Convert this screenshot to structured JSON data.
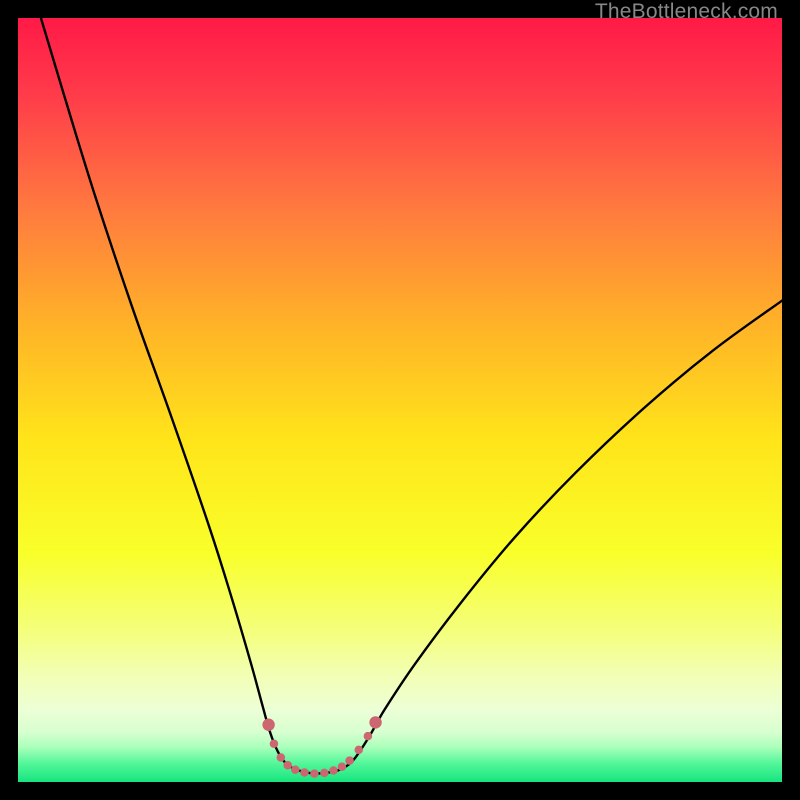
{
  "watermark": "TheBottleneck.com",
  "chart_data": {
    "type": "line",
    "title": "",
    "xlabel": "",
    "ylabel": "",
    "xlim": [
      0,
      100
    ],
    "ylim": [
      0,
      100
    ],
    "background_gradient_stops": [
      {
        "offset": 0.0,
        "color": "#ff1a47"
      },
      {
        "offset": 0.1,
        "color": "#ff3b4a"
      },
      {
        "offset": 0.25,
        "color": "#ff7a3f"
      },
      {
        "offset": 0.4,
        "color": "#ffb228"
      },
      {
        "offset": 0.55,
        "color": "#ffe41a"
      },
      {
        "offset": 0.7,
        "color": "#f9ff2a"
      },
      {
        "offset": 0.8,
        "color": "#f4ff7a"
      },
      {
        "offset": 0.86,
        "color": "#f2ffb4"
      },
      {
        "offset": 0.905,
        "color": "#edffd6"
      },
      {
        "offset": 0.935,
        "color": "#d7ffd0"
      },
      {
        "offset": 0.955,
        "color": "#a8ffba"
      },
      {
        "offset": 0.975,
        "color": "#55f79a"
      },
      {
        "offset": 1.0,
        "color": "#16e57f"
      }
    ],
    "series": [
      {
        "name": "bottleneck-curve",
        "stroke": "#000000",
        "stroke_width": 2.4,
        "points": [
          {
            "x": 3.0,
            "y": 100.0
          },
          {
            "x": 6.0,
            "y": 90.0
          },
          {
            "x": 10.0,
            "y": 77.0
          },
          {
            "x": 15.0,
            "y": 62.0
          },
          {
            "x": 20.0,
            "y": 48.0
          },
          {
            "x": 25.0,
            "y": 33.5
          },
          {
            "x": 28.0,
            "y": 24.0
          },
          {
            "x": 30.5,
            "y": 15.5
          },
          {
            "x": 32.0,
            "y": 10.0
          },
          {
            "x": 33.0,
            "y": 6.5
          },
          {
            "x": 34.0,
            "y": 4.0
          },
          {
            "x": 35.0,
            "y": 2.5
          },
          {
            "x": 36.0,
            "y": 1.8
          },
          {
            "x": 37.5,
            "y": 1.3
          },
          {
            "x": 39.0,
            "y": 1.1
          },
          {
            "x": 41.0,
            "y": 1.3
          },
          {
            "x": 42.5,
            "y": 1.8
          },
          {
            "x": 44.0,
            "y": 3.0
          },
          {
            "x": 46.0,
            "y": 6.0
          },
          {
            "x": 48.0,
            "y": 9.5
          },
          {
            "x": 52.0,
            "y": 15.5
          },
          {
            "x": 58.0,
            "y": 23.5
          },
          {
            "x": 65.0,
            "y": 32.0
          },
          {
            "x": 73.0,
            "y": 40.5
          },
          {
            "x": 82.0,
            "y": 49.0
          },
          {
            "x": 91.0,
            "y": 56.5
          },
          {
            "x": 100.0,
            "y": 63.0
          }
        ]
      },
      {
        "name": "valley-highlight",
        "stroke": "#cc6670",
        "stroke_width": 8.5,
        "linecap": "round",
        "points": [
          {
            "x": 32.8,
            "y": 7.5
          },
          {
            "x": 33.5,
            "y": 5.0
          },
          {
            "x": 34.4,
            "y": 3.2
          },
          {
            "x": 35.3,
            "y": 2.2
          },
          {
            "x": 36.3,
            "y": 1.6
          },
          {
            "x": 37.5,
            "y": 1.25
          },
          {
            "x": 38.8,
            "y": 1.1
          },
          {
            "x": 40.1,
            "y": 1.2
          },
          {
            "x": 41.3,
            "y": 1.5
          },
          {
            "x": 42.4,
            "y": 2.0
          },
          {
            "x": 43.4,
            "y": 2.8
          },
          {
            "x": 44.6,
            "y": 4.2
          },
          {
            "x": 45.8,
            "y": 6.0
          },
          {
            "x": 46.8,
            "y": 7.8
          }
        ],
        "dot_radius_end": 6.2
      }
    ]
  }
}
